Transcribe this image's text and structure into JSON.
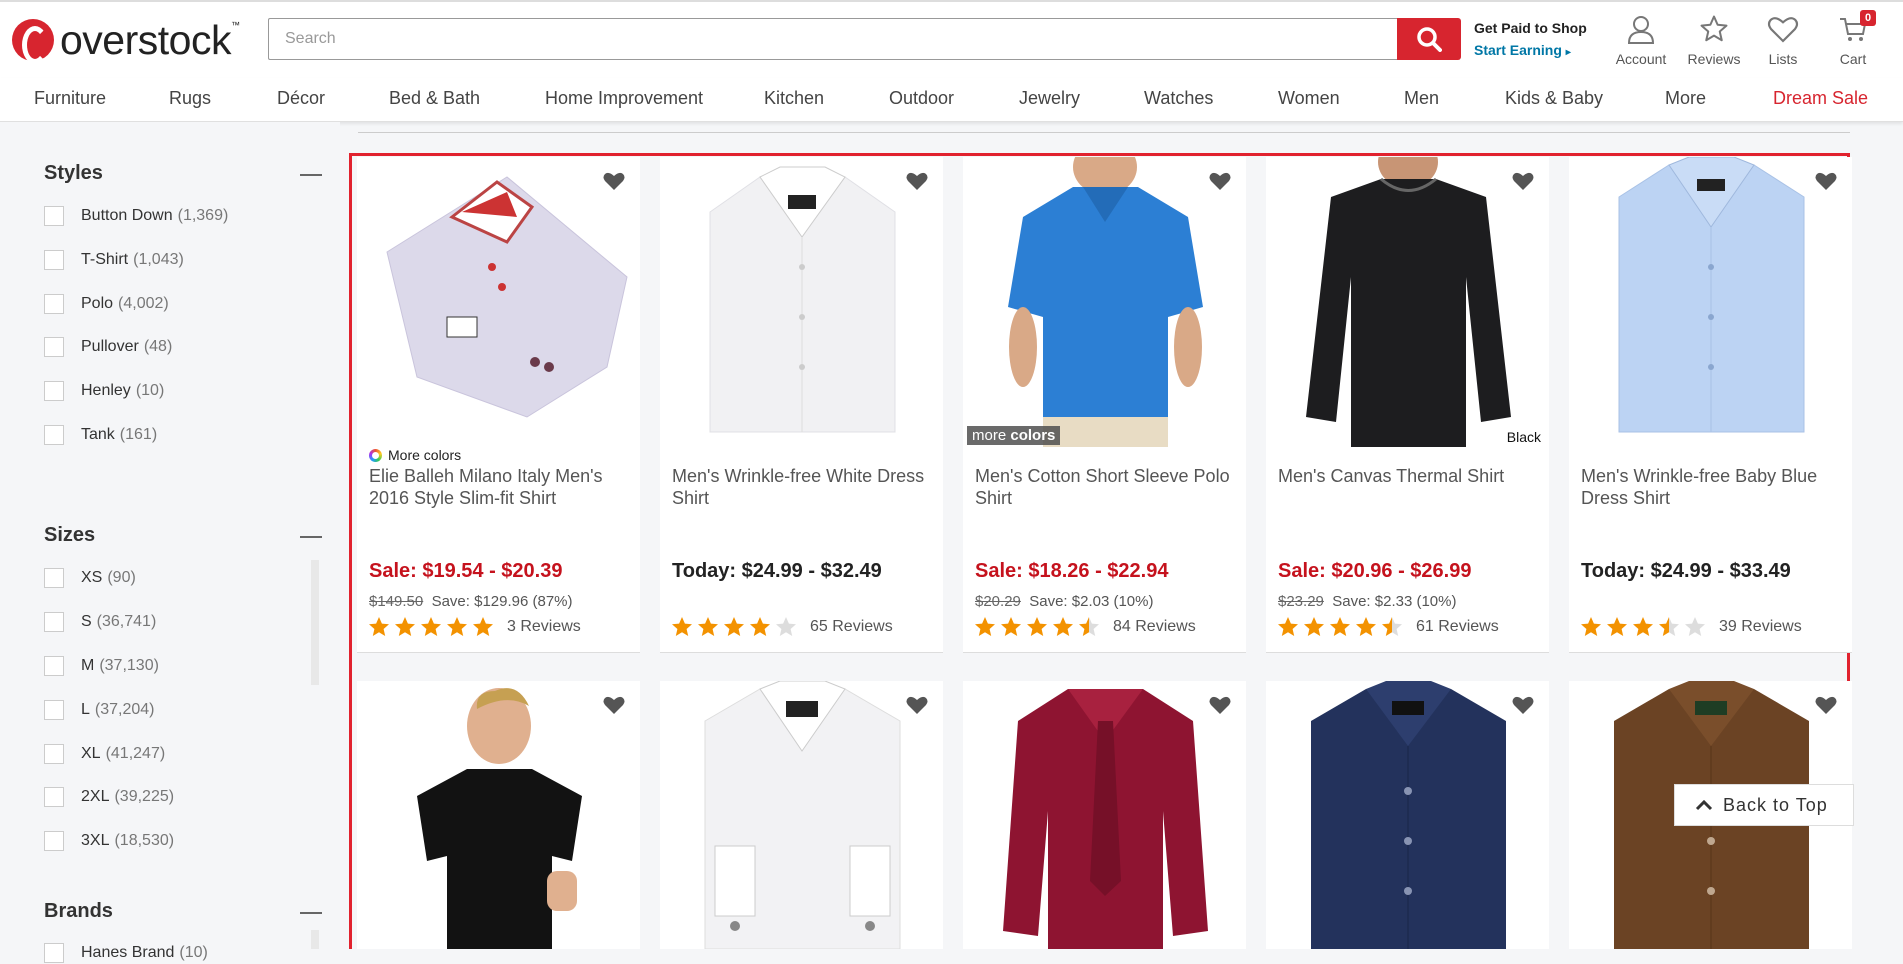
{
  "header": {
    "logo_text": "overstock",
    "logo_tm": "™",
    "search_placeholder": "Search",
    "get_paid_line1": "Get Paid to Shop",
    "get_paid_line2": "Start Earning",
    "account_label": "Account",
    "reviews_label": "Reviews",
    "lists_label": "Lists",
    "cart_label": "Cart",
    "cart_count": "0"
  },
  "nav": [
    "Furniture",
    "Rugs",
    "Décor",
    "Bed & Bath",
    "Home Improvement",
    "Kitchen",
    "Outdoor",
    "Jewelry",
    "Watches",
    "Women",
    "Men",
    "Kids & Baby",
    "More",
    "Dream Sale"
  ],
  "sidebar": {
    "styles": {
      "title": "Styles",
      "options": [
        {
          "label": "Button Down",
          "count": "(1,369)"
        },
        {
          "label": "T-Shirt",
          "count": "(1,043)"
        },
        {
          "label": "Polo",
          "count": "(4,002)"
        },
        {
          "label": "Pullover",
          "count": "(48)"
        },
        {
          "label": "Henley",
          "count": "(10)"
        },
        {
          "label": "Tank",
          "count": "(161)"
        }
      ]
    },
    "sizes": {
      "title": "Sizes",
      "options": [
        {
          "label": "XS",
          "count": "(90)"
        },
        {
          "label": "S",
          "count": "(36,741)"
        },
        {
          "label": "M",
          "count": "(37,130)"
        },
        {
          "label": "L",
          "count": "(37,204)"
        },
        {
          "label": "XL",
          "count": "(41,247)"
        },
        {
          "label": "2XL",
          "count": "(39,225)"
        },
        {
          "label": "3XL",
          "count": "(18,530)"
        }
      ]
    },
    "brands": {
      "title": "Brands",
      "first_partial": "Hanes Brand",
      "first_partial_count": "(10)"
    }
  },
  "products": [
    {
      "name": "Elie Balleh Milano Italy Men's 2016 Style Slim-fit Shirt",
      "more_colors": "More colors",
      "price_prefix": "Sale:",
      "price": "Sale: $19.54 - $20.39",
      "was": "$149.50",
      "save": "Save: $129.96 (87%)",
      "rating": 5,
      "reviews": "3 Reviews"
    },
    {
      "name": "Men's Wrinkle-free White Dress Shirt",
      "price": "Today: $24.99 - $32.49",
      "rating": 4,
      "reviews": "65 Reviews"
    },
    {
      "name": "Men's Cotton Short Sleeve Polo Shirt",
      "badge_more": "more",
      "badge_colors": "colors",
      "price": "Sale: $18.26 - $22.94",
      "was": "$20.29",
      "save": "Save: $2.03 (10%)",
      "rating": 4.5,
      "reviews": "84 Reviews"
    },
    {
      "name": "Men's Canvas Thermal Shirt",
      "badge_color": "Black",
      "price": "Sale: $20.96 - $26.99",
      "was": "$23.29",
      "save": "Save: $2.33 (10%)",
      "rating": 4.5,
      "reviews": "61 Reviews"
    },
    {
      "name": "Men's Wrinkle-free Baby Blue Dress Shirt",
      "price": "Today: $24.99 - $33.49",
      "rating": 3.5,
      "reviews": "39 Reviews"
    }
  ],
  "back_to_top": "Back to Top",
  "colors": {
    "brand_red": "#d7252f",
    "sale_red": "#c5121d",
    "star": "#f39200",
    "link_blue": "#0077a6"
  }
}
